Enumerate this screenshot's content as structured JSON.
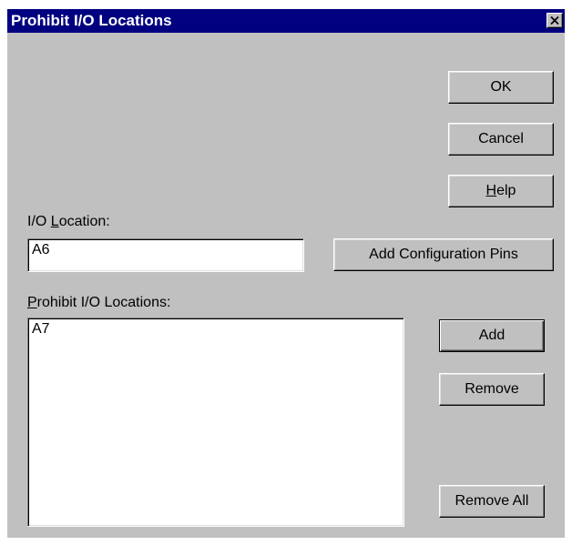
{
  "window": {
    "title": "Prohibit I/O Locations"
  },
  "buttons": {
    "ok": "OK",
    "cancel": "Cancel",
    "help_accel": "H",
    "help_rest": "elp",
    "add_config_pins": "Add Configuration Pins",
    "add": "Add",
    "remove": "Remove",
    "remove_all": "Remove All"
  },
  "io_location": {
    "label_pre": "I/O ",
    "label_accel": "L",
    "label_post": "ocation:",
    "value": "A6"
  },
  "prohibit_list": {
    "label_accel": "P",
    "label_rest": "rohibit I/O Locations:",
    "items": [
      "A7"
    ]
  },
  "icons": {
    "close": "close-icon"
  },
  "colors": {
    "titlebar": "#000080",
    "dialog_bg": "#c0c0c0",
    "field_bg": "#ffffff"
  }
}
